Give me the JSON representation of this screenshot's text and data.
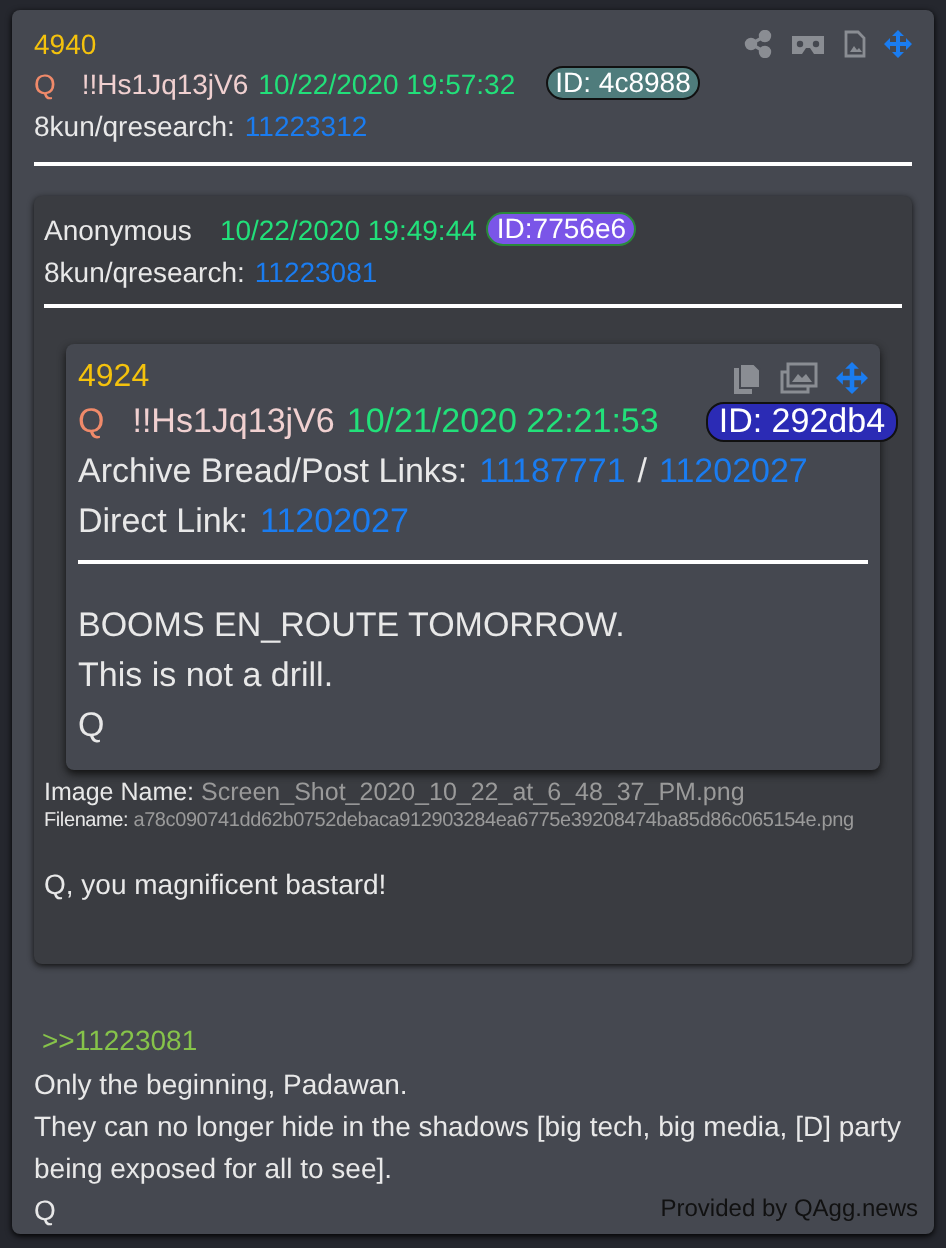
{
  "post": {
    "number": "4940",
    "author": "Q",
    "tripcode": "!!Hs1Jq13jV6",
    "timestamp": "10/22/2020 19:57:32",
    "id": {
      "label": "ID: 4c8988",
      "color": "#4f7c7c"
    },
    "board": "8kun/qresearch:",
    "post_link": "11223312",
    "quoted_post": {
      "author": "Anonymous",
      "timestamp": "10/22/2020 19:49:44",
      "id": {
        "label": "ID:7756e6",
        "color": "#7a55e8"
      },
      "board": "8kun/qresearch:",
      "post_link": "11223081",
      "embedded_post": {
        "number": "4924",
        "author": "Q",
        "tripcode": "!!Hs1Jq13jV6",
        "timestamp": "10/21/2020 22:21:53",
        "id": {
          "label": "ID: 292db4",
          "color": "#2b2bb5"
        },
        "archive_label": "Archive Bread/Post Links:",
        "archive_links": [
          "11187771",
          "11202027"
        ],
        "separator": "/",
        "direct_label": "Direct Link:",
        "direct_link": "11202027",
        "body": [
          "BOOMS EN_ROUTE TOMORROW.",
          "This is not a drill.",
          "Q"
        ]
      },
      "image_name_label": "Image Name:",
      "image_name": "Screen_Shot_2020_10_22_at_6_48_37_PM.png",
      "filename_label": "Filename:",
      "filename": "a78c090741dd62b0752debaca912903284ea6775e39208474ba85d86c065154e.png",
      "body": [
        "Q, you magnificent bastard!"
      ]
    },
    "reply_link": ">>11223081",
    "body": [
      "Only the beginning, Padawan.",
      "They can no longer hide in the shadows [big tech, big media, [D] party being exposed for all to see].",
      "Q"
    ]
  },
  "footer": "Provided by QAgg.news"
}
